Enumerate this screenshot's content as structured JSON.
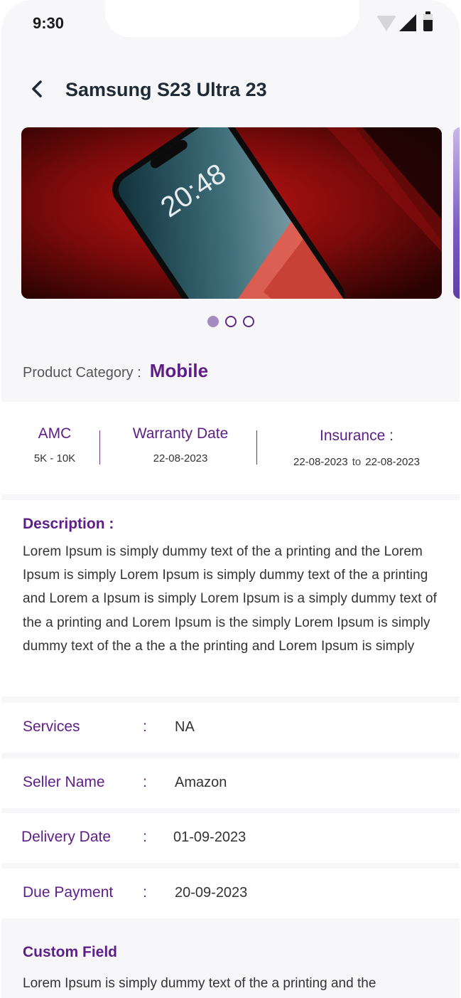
{
  "status_bar": {
    "time": "9:30"
  },
  "header": {
    "title": "Samsung S23 Ultra 23"
  },
  "carousel": {
    "slide_count": 3,
    "active_index": 0,
    "lock_time": "20:48"
  },
  "category": {
    "label": "Product Category :",
    "value": "Mobile"
  },
  "info": {
    "amc": {
      "label": "AMC",
      "value": "5K - 10K"
    },
    "warranty": {
      "label": "Warranty Date",
      "value": "22-08-2023"
    },
    "insurance": {
      "label": "Insurance :",
      "from": "22-08-2023",
      "to_word": "to",
      "to": "22-08-2023"
    }
  },
  "description": {
    "title": "Description :",
    "body": "Lorem Ipsum is simply dummy text of the a printing and the Lorem Ipsum is simply Lorem Ipsum is simply dummy text of the a printing and Lorem a Ipsum is simply Lorem Ipsum is a simply dummy text of the a printing and Lorem Ipsum is the simply Lorem Ipsum is simply dummy text of the a the a the printing and Lorem Ipsum is simply"
  },
  "details": [
    {
      "label": "Services",
      "value": "NA"
    },
    {
      "label": "Seller Name",
      "value": "Amazon"
    },
    {
      "label": "Delivery Date",
      "value": "01-09-2023"
    },
    {
      "label": "Due Payment",
      "value": "20-09-2023"
    }
  ],
  "colon": ":",
  "custom_field": {
    "title": "Custom Field",
    "body": "Lorem Ipsum is simply dummy text of the a printing and the"
  },
  "colors": {
    "accent": "#5d1e88",
    "background": "#f7f7f9"
  }
}
